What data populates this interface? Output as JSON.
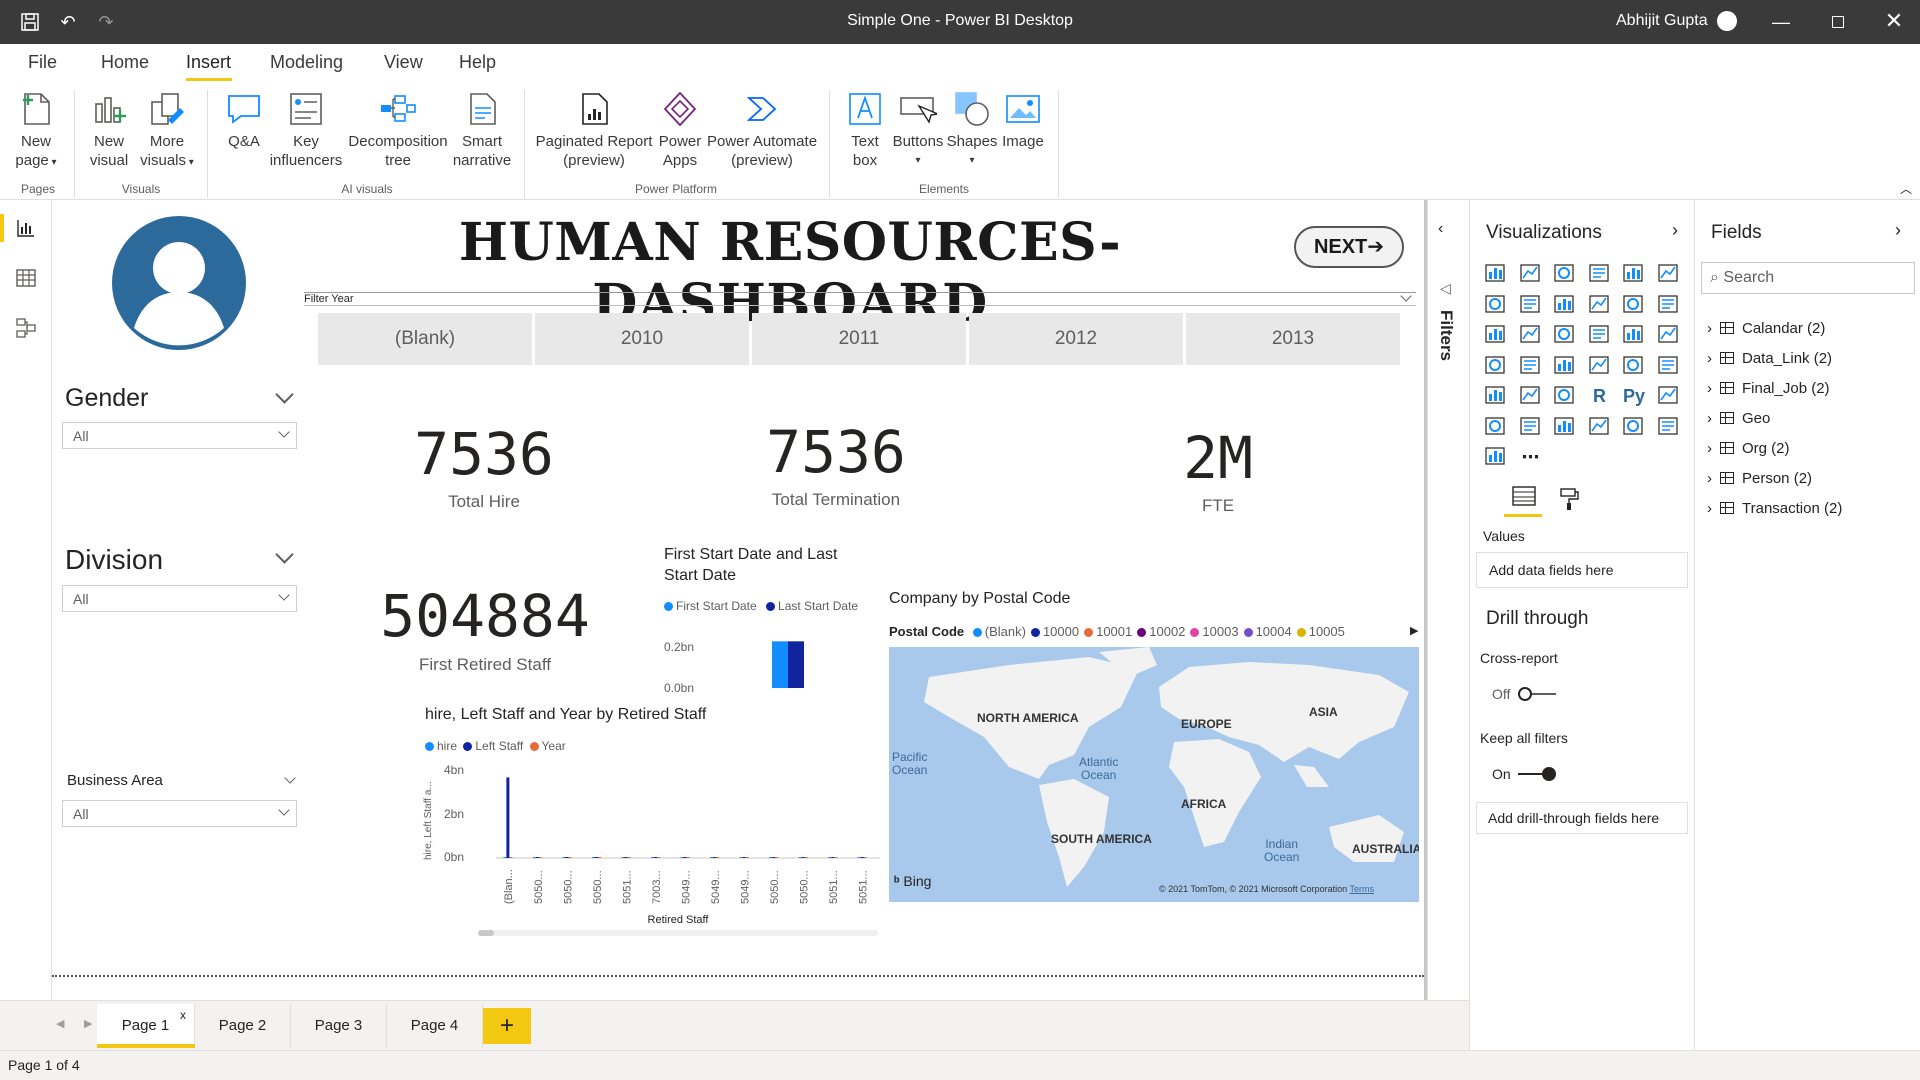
{
  "window": {
    "title": "Simple One - Power BI Desktop",
    "user": "Abhijit Gupta"
  },
  "menu": [
    "File",
    "Home",
    "Insert",
    "Modeling",
    "View",
    "Help"
  ],
  "ribbon": {
    "new_page": "New\npage",
    "new_visual": "New\nvisual",
    "more_visuals": "More\nvisuals",
    "qa": "Q&A",
    "key_influencers": "Key\ninfluencers",
    "decomposition_tree": "Decomposition\ntree",
    "smart_narrative": "Smart\nnarrative",
    "paginated_report": "Paginated Report\n(preview)",
    "power_apps": "Power\nApps",
    "power_automate": "Power Automate\n(preview)",
    "text_box": "Text\nbox",
    "buttons": "Buttons",
    "shapes": "Shapes",
    "image": "Image",
    "groups": {
      "pages": "Pages",
      "visuals": "Visuals",
      "ai": "AI visuals",
      "platform": "Power Platform",
      "elements": "Elements"
    }
  },
  "dashboard": {
    "title": "HUMAN RESOURCES- DASHBOARD",
    "next_button": "NEXT",
    "filter_year_label": "Filter Year",
    "years": [
      "(Blank)",
      "2010",
      "2011",
      "2012",
      "2013"
    ],
    "slicers": {
      "gender": {
        "title": "Gender",
        "value": "All"
      },
      "division": {
        "title": "Division",
        "value": "All"
      },
      "business_area": {
        "title": "Business Area",
        "value": "All"
      }
    },
    "kpis": {
      "total_hire": {
        "value": "7536",
        "label": "Total Hire"
      },
      "total_termination": {
        "value": "7536",
        "label": "Total Termination"
      },
      "fte": {
        "value": "2M",
        "label": "FTE"
      },
      "first_retired": {
        "value": "504884",
        "label": "First Retired Staff"
      }
    },
    "map": {
      "title": "Company by Postal Code",
      "legend_title": "Postal Code",
      "legend": [
        {
          "label": "(Blank)",
          "color": "#118dff"
        },
        {
          "label": "10000",
          "color": "#12239e"
        },
        {
          "label": "10001",
          "color": "#e66c37"
        },
        {
          "label": "10002",
          "color": "#6b007b"
        },
        {
          "label": "10003",
          "color": "#e044a7"
        },
        {
          "label": "10004",
          "color": "#744ec2"
        },
        {
          "label": "10005",
          "color": "#d9b300"
        }
      ],
      "labels": {
        "na": "NORTH AMERICA",
        "eu": "EUROPE",
        "asia": "ASIA",
        "africa": "AFRICA",
        "sa": "SOUTH AMERICA",
        "aus": "AUSTRALIA",
        "pac": "Pacific\nOcean",
        "atl": "Atlantic\nOcean",
        "ind": "Indian\nOcean"
      },
      "bing": "Bing",
      "copyright": "© 2021 TomTom, © 2021 Microsoft Corporation",
      "terms": "Terms"
    }
  },
  "chart_data": [
    {
      "type": "bar",
      "title": "First Start Date and Last\nStart Date",
      "series": [
        {
          "name": "First Start Date",
          "values": [
            0.28
          ],
          "color": "#118dff"
        },
        {
          "name": "Last Start Date",
          "values": [
            0.28
          ],
          "color": "#12239e"
        }
      ],
      "categories": [
        ""
      ],
      "ytick_labels": [
        "0.2bn",
        "0.0bn"
      ],
      "ylim": [
        0,
        0.3
      ]
    },
    {
      "type": "bar",
      "title": "hire, Left Staff and Year by Retired Staff",
      "xlabel": "Retired Staff",
      "ylabel": "hire, Left Staff a...",
      "ytick_labels": [
        "4bn",
        "2bn",
        "0bn"
      ],
      "ylim": [
        0,
        4
      ],
      "categories": [
        "(Blan...",
        "5050...",
        "5050...",
        "5050...",
        "5051...",
        "7003...",
        "5049...",
        "5049...",
        "5049...",
        "5050...",
        "5050...",
        "5051...",
        "5051..."
      ],
      "series": [
        {
          "name": "hire",
          "values": [
            0,
            0,
            0,
            0,
            0,
            0,
            0,
            0,
            0,
            0,
            0,
            0,
            0
          ],
          "color": "#118dff"
        },
        {
          "name": "Left Staff",
          "values": [
            3.75,
            0,
            0,
            0,
            0,
            0,
            0,
            0,
            0,
            0,
            0,
            0,
            0
          ],
          "color": "#12239e"
        },
        {
          "name": "Year",
          "values": [
            0,
            0,
            0,
            0,
            0,
            0,
            0,
            0,
            0,
            0,
            0,
            0,
            0
          ],
          "color": "#e66c37"
        }
      ]
    }
  ],
  "panes": {
    "filters": "Filters",
    "visualizations": "Visualizations",
    "values_label": "Values",
    "add_data_fields": "Add data fields here",
    "drill_through": "Drill through",
    "cross_report": "Cross-report",
    "cross_report_state": "Off",
    "keep_all_filters": "Keep all filters",
    "keep_all_state": "On",
    "add_drill_fields": "Add drill-through fields here",
    "fields": "Fields",
    "search_placeholder": "Search",
    "tables": [
      "Calandar (2)",
      "Data_Link (2)",
      "Final_Job (2)",
      "Geo",
      "Org (2)",
      "Person (2)",
      "Transaction (2)"
    ]
  },
  "pages": [
    "Page 1",
    "Page 2",
    "Page 3",
    "Page 4"
  ],
  "status": "Page 1 of 4",
  "colors": {
    "accent": "#f2c811",
    "brand_blue": "#1f5b8f"
  }
}
